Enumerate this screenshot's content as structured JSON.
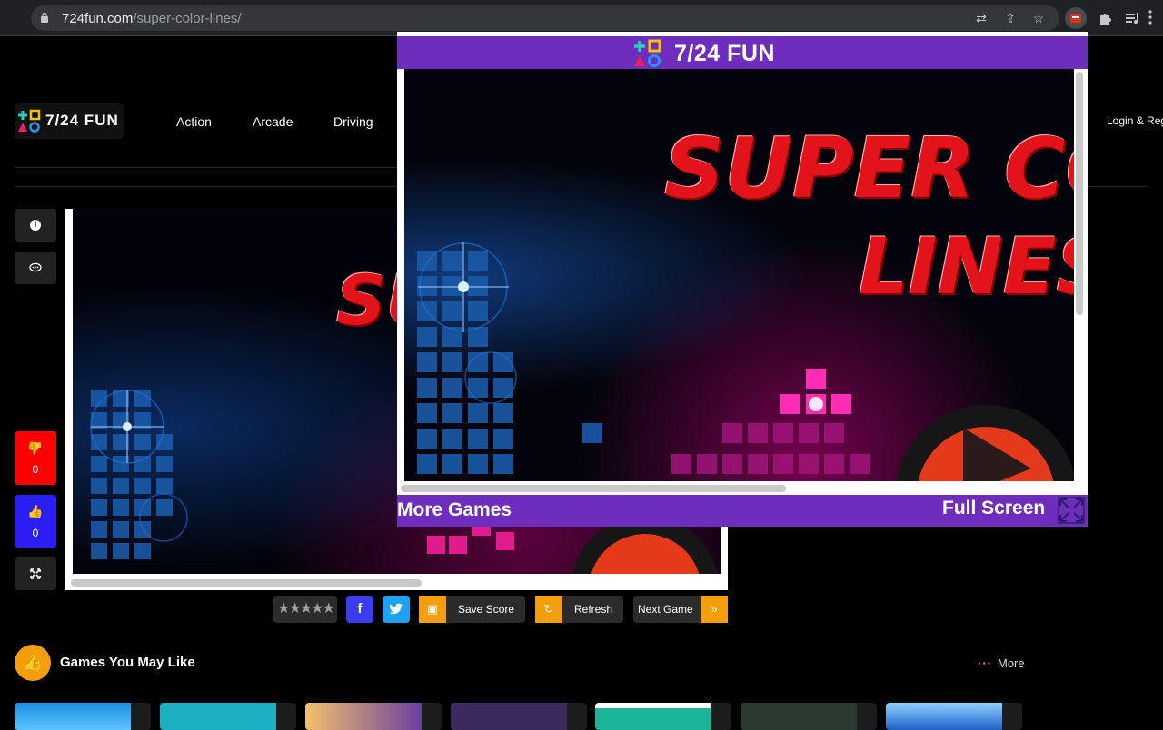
{
  "browser": {
    "url_domain": "724fun.com",
    "url_path": "/super-color-lines/",
    "icons": [
      "lock-icon",
      "translate-icon",
      "share-icon",
      "star-icon",
      "extension-active-icon",
      "puzzle-icon",
      "media-icon"
    ]
  },
  "site": {
    "logo_text": "7/24 FUN",
    "nav": [
      "Action",
      "Arcade",
      "Driving"
    ],
    "login": "Login & Reg"
  },
  "side": {
    "dislike_count": "0",
    "like_count": "0"
  },
  "actions": {
    "rating_stars": "★★★★★",
    "save_score": "Save Score",
    "refresh": "Refresh",
    "next_game": "Next Game",
    "next_arrow": "»"
  },
  "section": {
    "title": "Games You May Like",
    "more": "More"
  },
  "popup": {
    "title": "7/24 FUN",
    "more_games": "More Games",
    "full_screen": "Full Screen",
    "game_title_line1": "SUPER CO",
    "game_title_line2": "LINES",
    "bg_title_fragment": "SU"
  },
  "colors": {
    "popup_purple": "#6f2dbd",
    "accent_orange": "#f59e0b",
    "dislike_red": "#ff0000",
    "like_blue": "#2b1ef2",
    "facebook_blue": "#3b3bf0",
    "twitter_blue": "#1da1f2"
  }
}
